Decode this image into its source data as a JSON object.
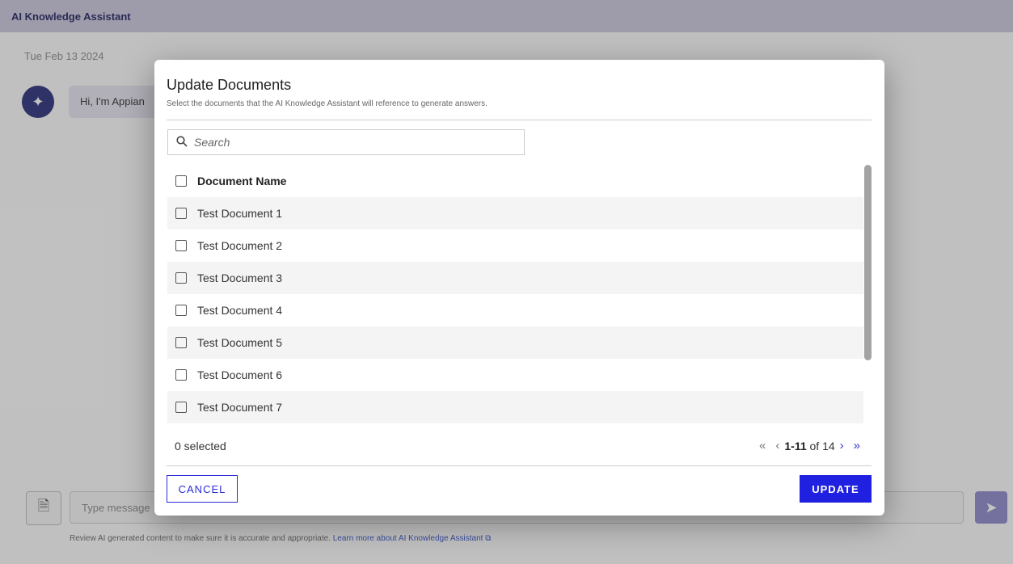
{
  "app": {
    "title": "AI Knowledge Assistant",
    "date": "Tue Feb 13 2024",
    "greeting": "Hi, I'm Appian",
    "message_placeholder": "Type message",
    "disclaimer_text": "Review AI generated content to make sure it is accurate and appropriate.",
    "disclaimer_link": "Learn more about AI Knowledge Assistant"
  },
  "modal": {
    "title": "Update Documents",
    "subtitle": "Select the documents that the AI Knowledge Assistant will reference to generate answers.",
    "search_placeholder": "Search",
    "column_header": "Document Name",
    "documents": [
      "Test Document 1",
      "Test Document 2",
      "Test Document 3",
      "Test Document 4",
      "Test Document 5",
      "Test Document 6",
      "Test Document 7"
    ],
    "selected_count": "0 selected",
    "pagination": {
      "range": "1-11",
      "of_text": "of 14"
    },
    "cancel_label": "CANCEL",
    "update_label": "UPDATE"
  },
  "colors": {
    "accent": "#2020e0",
    "header_bg": "#c9c6da",
    "avatar": "#2a2f7a"
  },
  "icons": {
    "search": "search-icon",
    "first_page": "first-page-icon",
    "prev_page": "prev-page-icon",
    "next_page": "next-page-icon",
    "last_page": "last-page-icon",
    "document": "document-icon",
    "send": "send-icon",
    "external_link": "external-link-icon"
  }
}
